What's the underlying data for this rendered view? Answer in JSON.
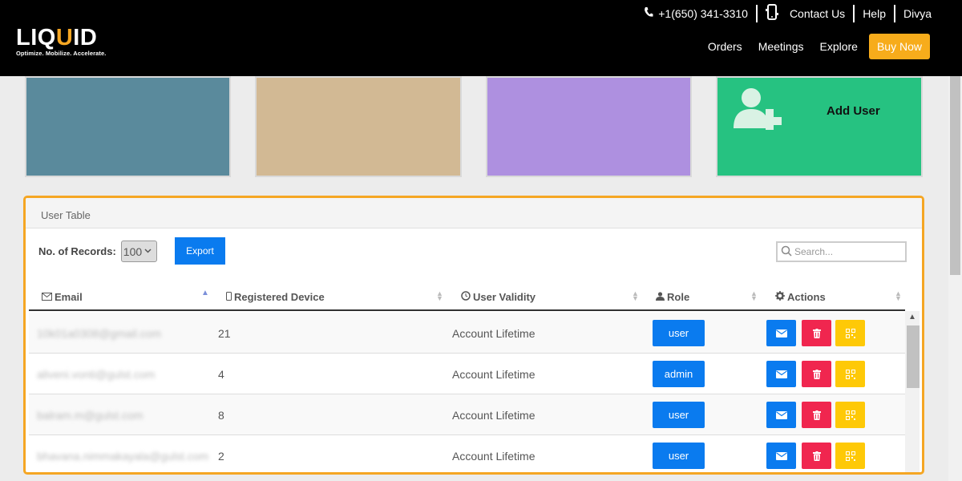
{
  "header": {
    "logo_text_a": "LIQ",
    "logo_text_b": "U",
    "logo_text_c": "ID",
    "logo_tagline": "Optimize. Mobilize. Accelerate.",
    "phone": "+1(650) 341-3310",
    "contact": "Contact Us",
    "help": "Help",
    "user": "Divya",
    "nav": [
      "Orders",
      "Meetings",
      "Explore"
    ],
    "buy_now": "Buy Now",
    "buy_color": "#f7ac1b"
  },
  "cards": {
    "colors": [
      "#5a8a9c",
      "#d2b994",
      "#ae90e0",
      "#26c281"
    ],
    "add_user_label": "Add User",
    "add_user_icon": "add-user-icon"
  },
  "table": {
    "title": "User Table",
    "records_label": "No. of Records:",
    "records_value": "100",
    "export_label": "Export",
    "search_placeholder": "Search...",
    "columns": [
      "Email",
      "Registered Device",
      "User Validity",
      "Role",
      "Actions"
    ],
    "rows": [
      {
        "email": "10k01a0308@gmail.com",
        "devices": "21",
        "validity": "Account Lifetime",
        "role": "user"
      },
      {
        "email": "aliveni.vonti@gulst.com",
        "devices": "4",
        "validity": "Account Lifetime",
        "role": "admin"
      },
      {
        "email": "balram.m@gulst.com",
        "devices": "8",
        "validity": "Account Lifetime",
        "role": "user"
      },
      {
        "email": "bhavana.nimmakayala@gulst.com",
        "devices": "2",
        "validity": "Account Lifetime",
        "role": "user"
      }
    ],
    "accent": "#0a7bef",
    "delete_color": "#f0264f",
    "qr_color": "#fec907",
    "highlight_color": "#f5a623"
  }
}
